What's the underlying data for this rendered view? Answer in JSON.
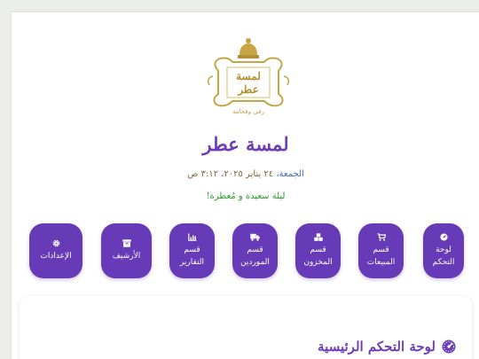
{
  "brand": {
    "logo_text_top": "لمسة",
    "logo_text_bottom": "عطر",
    "logo_caption": "رقي وفخامة",
    "title": "لمسة عطر"
  },
  "header": {
    "day_label": "الجمعة،",
    "date_text": "٢٤ يناير ٢٠٢٥، ٣:١٢ ص",
    "greeting": "ليلة سعيدة و مُعطرة!"
  },
  "nav": [
    {
      "label": "لوحة التحكم",
      "icon": "dashboard-icon"
    },
    {
      "label": "قسم المبيعات",
      "icon": "cart-icon"
    },
    {
      "label": "قسم المخزون",
      "icon": "boxes-icon"
    },
    {
      "label": "قسم الموردين",
      "icon": "truck-icon"
    },
    {
      "label": "قسم التقارير",
      "icon": "chart-icon"
    },
    {
      "label": "الأرشيف",
      "icon": "archive-icon"
    },
    {
      "label": "الإعدادات",
      "icon": "gear-icon"
    }
  ],
  "main": {
    "section_title": "لوحة التحكم الرئيسية",
    "section_icon": "dashboard-icon"
  },
  "colors": {
    "accent": "#673ab7",
    "title": "#6d3fb5",
    "greeting": "#2f9a2f",
    "gold": "#c8a544"
  }
}
